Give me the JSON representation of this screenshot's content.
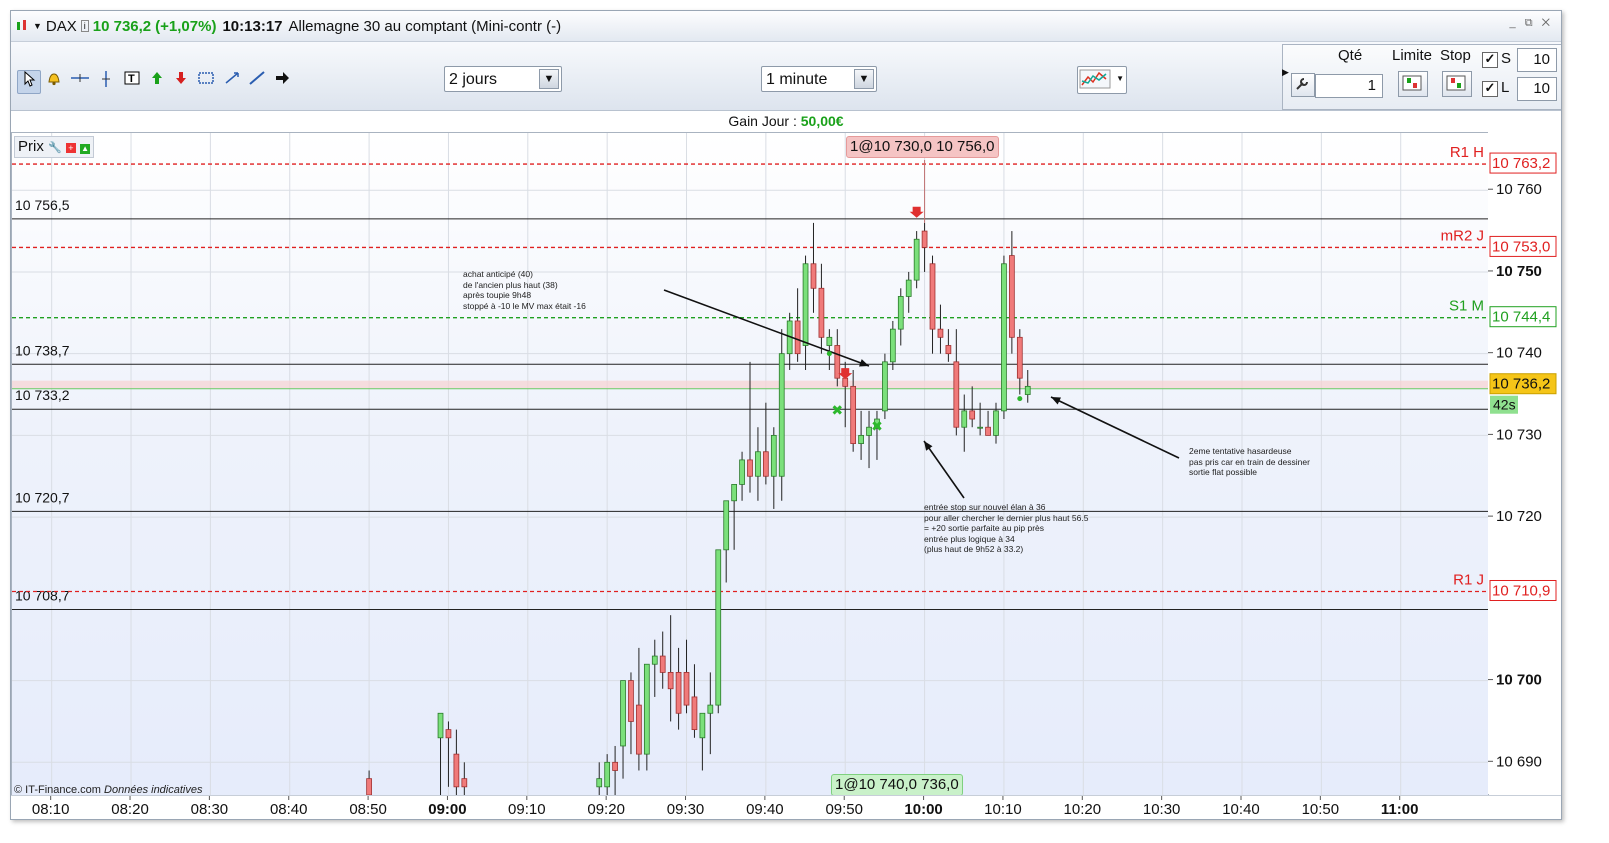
{
  "titlebar": {
    "symbol": "DAX",
    "price": "10 736,2",
    "change": "(+1,07%)",
    "time": "10:13:17",
    "name": "Allemagne 30 au comptant (Mini-contr (-)",
    "window_controls": "_ ⧉ ✕"
  },
  "toolbar": {
    "period": "2 jours",
    "interval": "1 minute",
    "tools": [
      "pointer-icon",
      "alert-bell-icon",
      "horizontal-line-icon",
      "vertical-line-icon",
      "text-icon",
      "buy-arrow-icon",
      "sell-arrow-icon",
      "rectangle-icon",
      "zoom-icon",
      "trendline-icon",
      "arrow-right-icon"
    ]
  },
  "order": {
    "qty_label": "Qté",
    "qty_value": "1",
    "limit_label": "Limite",
    "stop_label": "Stop",
    "s_label": "S",
    "s_value": "10",
    "l_label": "L",
    "l_value": "10"
  },
  "gain": {
    "label": "Gain Jour :",
    "value": "50,00€"
  },
  "chart": {
    "panel_label": "Prix",
    "position_top": "1@10 730,0",
    "position_top_price": "10 756,0",
    "position_bottom": "1@10 740,0",
    "position_bottom_price": "736,0",
    "countdown": "42s",
    "footer_source": "© IT-Finance.com",
    "footer_note": "Données indicatives",
    "pivots": [
      {
        "name": "R1 H",
        "value": "10 763,2",
        "color": "#e02020"
      },
      {
        "name": "mR2 J",
        "value": "10 753,0",
        "color": "#e02020"
      },
      {
        "name": "S1 M",
        "value": "10 744,4",
        "color": "#20a020"
      },
      {
        "name": "R1 J",
        "value": "10 710,9",
        "color": "#e02020"
      }
    ],
    "hlines": [
      "10 756,5",
      "10 738,7",
      "10 733,2",
      "10 720,7",
      "10 708,7"
    ],
    "current_price": "10 736,2",
    "notes": [
      "achat anticipé (40)\nde l'ancien plus haut (38)\naprès toupie 9h48\nstoppé à -10 le MV max était -16",
      "entrée stop sur nouvel élan à 36\npour aller chercher le dernier plus haut 56.5\n= +20 sortie parfaite au pip près\nentrée plus logique à 34\n(plus haut de 9h52 à 33.2)",
      "2eme tentative hasardeuse\npas pris car en train de dessiner\nsortie flat possible"
    ]
  },
  "chart_data": {
    "type": "candlestick",
    "title": "DAX",
    "xlabel": "",
    "ylabel": "",
    "x_ticks": [
      "08:10",
      "08:20",
      "08:30",
      "08:40",
      "08:50",
      "09:00",
      "09:10",
      "09:20",
      "09:30",
      "09:40",
      "09:50",
      "10:00",
      "10:10",
      "10:20",
      "10:30",
      "10:40",
      "10:50",
      "11:00"
    ],
    "x_bold_ticks": [
      "09:00",
      "10:00",
      "11:00"
    ],
    "y_ticks": [
      10760,
      10750,
      10740,
      10730,
      10720,
      10700,
      10690
    ],
    "y_bold_ticks": [
      10750,
      10700
    ],
    "ylim": [
      10686,
      10767
    ],
    "x_start_minute": 485,
    "x_end_minute": 671,
    "grid": true,
    "candles": [
      {
        "t": "08:50",
        "o": 10688,
        "h": 10689,
        "l": 10685,
        "c": 10686
      },
      {
        "t": "08:59",
        "o": 10693,
        "h": 10696,
        "l": 10684,
        "c": 10696
      },
      {
        "t": "09:00",
        "o": 10694,
        "h": 10695,
        "l": 10687,
        "c": 10693
      },
      {
        "t": "09:01",
        "o": 10691,
        "h": 10694,
        "l": 10686,
        "c": 10687
      },
      {
        "t": "09:02",
        "o": 10688,
        "h": 10690,
        "l": 10686,
        "c": 10687
      },
      {
        "t": "09:19",
        "o": 10687,
        "h": 10690,
        "l": 10686,
        "c": 10688
      },
      {
        "t": "09:20",
        "o": 10687,
        "h": 10691,
        "l": 10686,
        "c": 10690
      },
      {
        "t": "09:21",
        "o": 10690,
        "h": 10692,
        "l": 10685,
        "c": 10689
      },
      {
        "t": "09:22",
        "o": 10692,
        "h": 10698,
        "l": 10688,
        "c": 10700
      },
      {
        "t": "09:23",
        "o": 10700,
        "h": 10701,
        "l": 10691,
        "c": 10695
      },
      {
        "t": "09:24",
        "o": 10697,
        "h": 10704,
        "l": 10689,
        "c": 10691
      },
      {
        "t": "09:25",
        "o": 10691,
        "h": 10701,
        "l": 10689,
        "c": 10702
      },
      {
        "t": "09:26",
        "o": 10702,
        "h": 10705,
        "l": 10698,
        "c": 10703
      },
      {
        "t": "09:27",
        "o": 10703,
        "h": 10706,
        "l": 10699,
        "c": 10701
      },
      {
        "t": "09:28",
        "o": 10701,
        "h": 10708,
        "l": 10695,
        "c": 10699
      },
      {
        "t": "09:29",
        "o": 10701,
        "h": 10704,
        "l": 10694,
        "c": 10696
      },
      {
        "t": "09:30",
        "o": 10701,
        "h": 10705,
        "l": 10696,
        "c": 10697
      },
      {
        "t": "09:31",
        "o": 10698,
        "h": 10702,
        "l": 10693,
        "c": 10694
      },
      {
        "t": "09:32",
        "o": 10693,
        "h": 10696,
        "l": 10689,
        "c": 10696
      },
      {
        "t": "09:33",
        "o": 10696,
        "h": 10701,
        "l": 10691,
        "c": 10697
      },
      {
        "t": "09:34",
        "o": 10697,
        "h": 10716,
        "l": 10696,
        "c": 10716
      },
      {
        "t": "09:35",
        "o": 10716,
        "h": 10722,
        "l": 10712,
        "c": 10722
      },
      {
        "t": "09:36",
        "o": 10722,
        "h": 10724,
        "l": 10716,
        "c": 10724
      },
      {
        "t": "09:37",
        "o": 10724,
        "h": 10728,
        "l": 10722,
        "c": 10727
      },
      {
        "t": "09:38",
        "o": 10727,
        "h": 10739,
        "l": 10723,
        "c": 10725
      },
      {
        "t": "09:39",
        "o": 10725,
        "h": 10731,
        "l": 10722,
        "c": 10728
      },
      {
        "t": "09:40",
        "o": 10728,
        "h": 10734,
        "l": 10724,
        "c": 10725
      },
      {
        "t": "09:41",
        "o": 10725,
        "h": 10731,
        "l": 10721,
        "c": 10730
      },
      {
        "t": "09:42",
        "o": 10725,
        "h": 10743,
        "l": 10722,
        "c": 10740
      },
      {
        "t": "09:43",
        "o": 10740,
        "h": 10745,
        "l": 10738,
        "c": 10744
      },
      {
        "t": "09:44",
        "o": 10744,
        "h": 10748,
        "l": 10739,
        "c": 10740
      },
      {
        "t": "09:45",
        "o": 10741,
        "h": 10752,
        "l": 10738,
        "c": 10751
      },
      {
        "t": "09:46",
        "o": 10751,
        "h": 10756,
        "l": 10745,
        "c": 10748
      },
      {
        "t": "09:47",
        "o": 10748,
        "h": 10751,
        "l": 10740,
        "c": 10742
      },
      {
        "t": "09:48",
        "o": 10741,
        "h": 10743,
        "l": 10738,
        "c": 10742
      },
      {
        "t": "09:49",
        "o": 10741,
        "h": 10743,
        "l": 10736,
        "c": 10737
      },
      {
        "t": "09:50",
        "o": 10737,
        "h": 10739,
        "l": 10731,
        "c": 10736
      },
      {
        "t": "09:51",
        "o": 10736,
        "h": 10738,
        "l": 10728,
        "c": 10729
      },
      {
        "t": "09:52",
        "o": 10729,
        "h": 10733,
        "l": 10727,
        "c": 10730
      },
      {
        "t": "09:53",
        "o": 10730,
        "h": 10733,
        "l": 10726,
        "c": 10731
      },
      {
        "t": "09:54",
        "o": 10731,
        "h": 10733,
        "l": 10727,
        "c": 10732
      },
      {
        "t": "09:55",
        "o": 10733,
        "h": 10740,
        "l": 10732,
        "c": 10739
      },
      {
        "t": "09:56",
        "o": 10739,
        "h": 10744,
        "l": 10738,
        "c": 10743
      },
      {
        "t": "09:57",
        "o": 10743,
        "h": 10748,
        "l": 10741,
        "c": 10747
      },
      {
        "t": "09:58",
        "o": 10747,
        "h": 10750,
        "l": 10745,
        "c": 10749
      },
      {
        "t": "09:59",
        "o": 10749,
        "h": 10755,
        "l": 10748,
        "c": 10754
      },
      {
        "t": "10:00",
        "o": 10755,
        "h": 10756,
        "l": 10750,
        "c": 10753
      },
      {
        "t": "10:01",
        "o": 10751,
        "h": 10752,
        "l": 10740,
        "c": 10743
      },
      {
        "t": "10:02",
        "o": 10743,
        "h": 10746,
        "l": 10740,
        "c": 10742
      },
      {
        "t": "10:03",
        "o": 10741,
        "h": 10743,
        "l": 10739,
        "c": 10740
      },
      {
        "t": "10:04",
        "o": 10739,
        "h": 10743,
        "l": 10730,
        "c": 10731
      },
      {
        "t": "10:05",
        "o": 10731,
        "h": 10735,
        "l": 10728,
        "c": 10733
      },
      {
        "t": "10:06",
        "o": 10733,
        "h": 10736,
        "l": 10731,
        "c": 10732
      },
      {
        "t": "10:07",
        "o": 10731,
        "h": 10734,
        "l": 10730,
        "c": 10731
      },
      {
        "t": "10:08",
        "o": 10731,
        "h": 10733,
        "l": 10730,
        "c": 10730
      },
      {
        "t": "10:09",
        "o": 10730,
        "h": 10734,
        "l": 10729,
        "c": 10733
      },
      {
        "t": "10:10",
        "o": 10733,
        "h": 10752,
        "l": 10732,
        "c": 10751
      },
      {
        "t": "10:11",
        "o": 10752,
        "h": 10755,
        "l": 10740,
        "c": 10742
      },
      {
        "t": "10:12",
        "o": 10742,
        "h": 10743,
        "l": 10735,
        "c": 10737
      },
      {
        "t": "10:13",
        "o": 10735,
        "h": 10738,
        "l": 10734,
        "c": 10736
      }
    ]
  }
}
